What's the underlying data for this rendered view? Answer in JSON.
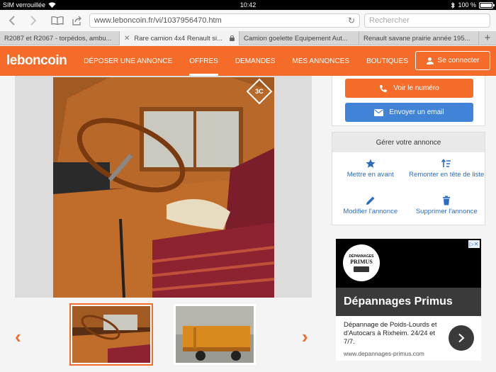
{
  "status_bar": {
    "carrier": "SIM verrouillée",
    "time": "10:42",
    "battery": "100 %",
    "battery_level": 1.0
  },
  "browser": {
    "url": "www.leboncoin.fr/vi/1037956470.htm",
    "search_placeholder": "Rechercher",
    "tabs": [
      {
        "label": "R2087 et R2067 - torpédos, ambu..."
      },
      {
        "label": "Rare camion 4x4 Renault si...",
        "active": true
      },
      {
        "label": "Camion goelette Equipement Aut..."
      },
      {
        "label": "Renault savane prairie année 195..."
      }
    ],
    "add_tab": "+"
  },
  "site": {
    "logo": "leboncoin",
    "nav": [
      "DÉPOSER UNE ANNONCE",
      "OFFRES",
      "DEMANDES",
      "MES ANNONCES",
      "BOUTIQUES"
    ],
    "active_nav": "OFFRES",
    "connect_label": "Se connecter",
    "brand_color": "#f56b2a"
  },
  "listing": {
    "photo_badge": "3C",
    "prev_arrow": "‹",
    "next_arrow": "›"
  },
  "sidebar": {
    "call_label": "Voir le numéro",
    "email_label": "Envoyer un email",
    "manage_title": "Gérer votre annonce",
    "actions": [
      {
        "label": "Mettre en avant",
        "icon": "star-icon"
      },
      {
        "label": "Remonter en tête de liste",
        "icon": "sort-up-icon"
      },
      {
        "label": "Modifier l'annonce",
        "icon": "pencil-icon"
      },
      {
        "label": "Supprimer l'annonce",
        "icon": "trash-icon"
      }
    ]
  },
  "ad": {
    "logo_top": "DÉPANNAGES",
    "logo_name": "PRIMUS",
    "title": "Dépannages Primus",
    "description": "Dépannage de Poids-Lourds et d'Autocars à Rixheim. 24/24 et 7/7.",
    "url": "www.depannages-primus.com"
  }
}
